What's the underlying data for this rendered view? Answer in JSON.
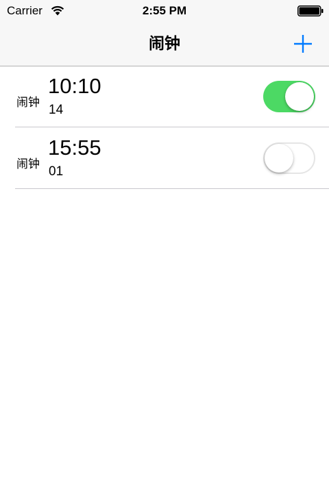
{
  "status_bar": {
    "carrier": "Carrier",
    "time": "2:55 PM",
    "wifi_icon": "wifi-icon",
    "battery_icon": "battery-icon"
  },
  "nav_bar": {
    "title": "闹钟",
    "add_icon": "plus-icon",
    "accent_color": "#007aff"
  },
  "alarms": [
    {
      "label": "闹钟",
      "time": "10:10",
      "subtitle": "14",
      "enabled": true
    },
    {
      "label": "闹钟",
      "time": "15:55",
      "subtitle": "01",
      "enabled": false
    }
  ],
  "colors": {
    "switch_on": "#4cd964",
    "bar_background": "#f7f7f7"
  }
}
